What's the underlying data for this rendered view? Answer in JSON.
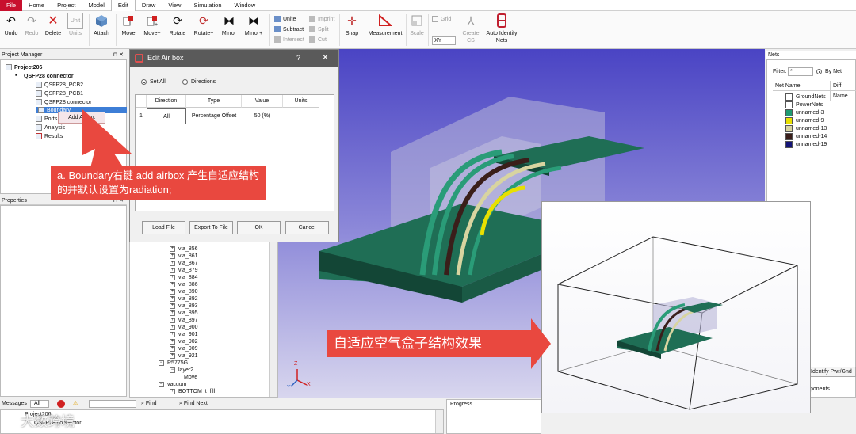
{
  "menu": [
    "File",
    "Home",
    "Project",
    "Model",
    "Edit",
    "Draw",
    "View",
    "Simulation",
    "Window"
  ],
  "ribbon": {
    "undo": "Undo",
    "redo": "Redo",
    "delete": "Delete",
    "units": "Units",
    "unit_icon": "Unit",
    "attach": "Attach",
    "move": "Move",
    "move_plus": "Move+",
    "rotate": "Rotate",
    "rotate_plus": "Rotate+",
    "mirror": "Mirror",
    "mirror_plus": "Mirror+",
    "unite": "Unite",
    "subtract": "Subtract",
    "intersect": "Intersect",
    "imprint": "Imprint",
    "split": "Split",
    "cut": "Cut",
    "snap": "Snap",
    "measurement": "Measurement",
    "scale": "Scale",
    "grid": "Grid",
    "grid_value": "XY",
    "create_cs_1": "Create",
    "create_cs_2": "CS",
    "auto_identify_1": "Auto Identify",
    "auto_identify_2": "Nets"
  },
  "project_manager": {
    "title": "Project Manager",
    "items": [
      "Project206",
      "QSFP28 connector",
      "QSFP28_PCB2",
      "QSFP28_PCB1",
      "QSFP28 connector",
      "Boundary",
      "Ports",
      "Analysis",
      "Results"
    ],
    "context_menu": "Add Airbox"
  },
  "properties": {
    "title": "Properties"
  },
  "dialog": {
    "title": "Edit Air box",
    "help": "?",
    "radio_set_all": "Set All",
    "radio_directions": "Directions",
    "columns": [
      "Direction",
      "Type",
      "Value",
      "Units"
    ],
    "row": {
      "index": "1",
      "direction": "All",
      "type": "Percentage Offset",
      "value": "50 (%)",
      "units": ""
    },
    "btn_load": "Load File",
    "btn_export": "Export To File",
    "btn_ok": "OK",
    "btn_cancel": "Cancel"
  },
  "tree": {
    "vias": [
      "via_856",
      "via_861",
      "via_867",
      "via_879",
      "via_884",
      "via_886",
      "via_890",
      "via_892",
      "via_893",
      "via_895",
      "via_897",
      "via_900",
      "via_901",
      "via_902",
      "via_909",
      "via_921"
    ],
    "r5775g": "R5775G",
    "layer2": "layer2",
    "move": "Move",
    "vacuum": "vacuum",
    "bottom_fill": "BOTTOM_t_fill"
  },
  "nets": {
    "title": "Nets",
    "filter_label": "Filter:",
    "filter_value": "*",
    "by_net": "By Net",
    "col_net": "Net Name",
    "col_diff": "Diff Name",
    "items": [
      {
        "name": "GroundNets",
        "color": "#ffffff"
      },
      {
        "name": "PowerNets",
        "color": "#ffffff"
      },
      {
        "name": "unnamed-3",
        "color": "#1e9a72"
      },
      {
        "name": "unnamed-9",
        "color": "#e8e000"
      },
      {
        "name": "unnamed-13",
        "color": "#d8d4a0"
      },
      {
        "name": "unnamed-14",
        "color": "#3a1e1a"
      },
      {
        "name": "unnamed-19",
        "color": "#141478"
      }
    ],
    "identify_btn": "Identify Pwr/Gnd",
    "components": "ponents"
  },
  "bottom": {
    "messages": "Messages",
    "all": "All",
    "find": "Find",
    "find_next": "Find Next",
    "progress": "Progress",
    "proj_line": "Project206",
    "conn_line": "QSFP28 connector"
  },
  "callouts": {
    "a": "a. Boundary右键 add airbox 产生自适应结构的并默认设置为radiation;",
    "b": "自适应空气盒子结构效果"
  },
  "watermark": "大数跨境",
  "axes": {
    "x": "X",
    "y": "Y",
    "z": "Z"
  },
  "colors": {
    "accent": "#c8102e",
    "callout": "#e9483f",
    "pcb": "#1f6e55",
    "viewport_top": "#4a44c4"
  }
}
